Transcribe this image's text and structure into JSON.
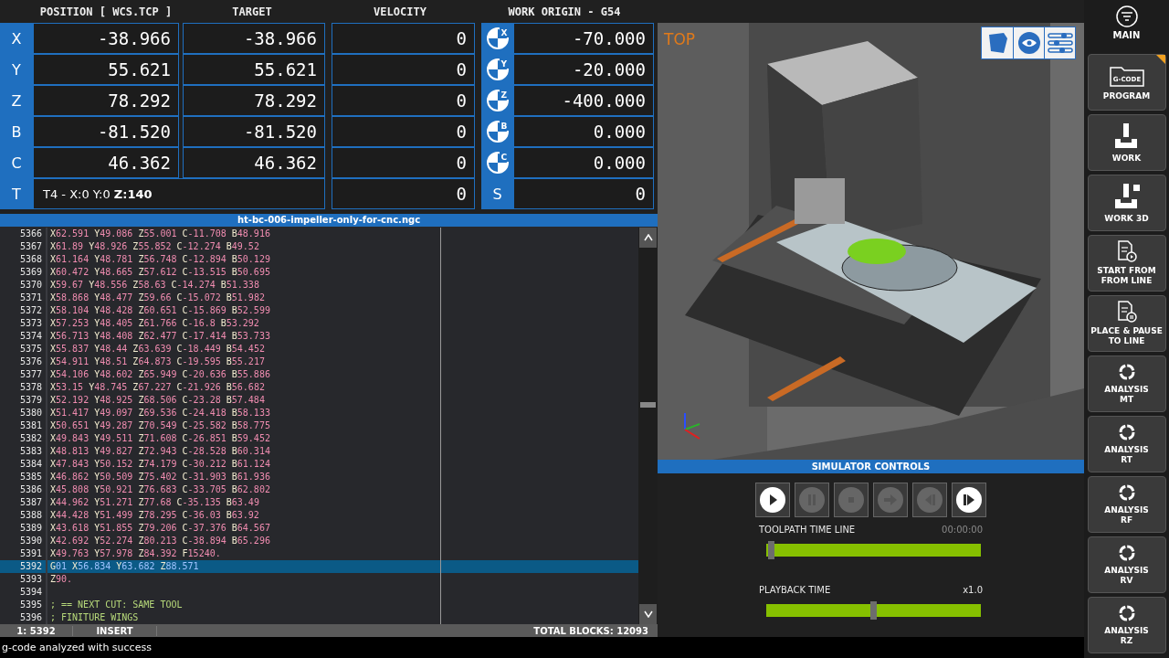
{
  "dro": {
    "headers": [
      "POSITION [ WCS.TCP ]",
      "TARGET",
      "VELOCITY",
      "WORK ORIGIN - G54"
    ],
    "axes": [
      {
        "label": "X",
        "position": {
          "value": "-38.966"
        },
        "target": {
          "value": "-38.966"
        },
        "velocity": {
          "value": "0"
        },
        "origin_letter": "X",
        "origin": {
          "value": "-70.000"
        }
      },
      {
        "label": "Y",
        "position": {
          "value": "55.621"
        },
        "target": {
          "value": "55.621"
        },
        "velocity": {
          "value": "0"
        },
        "origin_letter": "Y",
        "origin": {
          "value": "-20.000"
        }
      },
      {
        "label": "Z",
        "position": {
          "value": "78.292"
        },
        "target": {
          "value": "78.292"
        },
        "velocity": {
          "value": "0"
        },
        "origin_letter": "Z",
        "origin": {
          "value": "-400.000"
        }
      },
      {
        "label": "B",
        "position": {
          "value": "-81.520"
        },
        "target": {
          "value": "-81.520"
        },
        "velocity": {
          "value": "0"
        },
        "origin_letter": "B",
        "origin": {
          "value": "0.000"
        }
      },
      {
        "label": "C",
        "position": {
          "value": "46.362"
        },
        "target": {
          "value": "46.362"
        },
        "velocity": {
          "value": "0"
        },
        "origin_letter": "C",
        "origin": {
          "value": "0.000"
        }
      }
    ],
    "tool": {
      "label": "T",
      "text": "T4 - X:0 Y:0 **Z:140**",
      "velocity": {
        "value": "0"
      }
    },
    "spindle": {
      "label": "S",
      "value": "0"
    }
  },
  "editor": {
    "title": "ht-bc-006-impeller-only-for-cnc.ngc",
    "lines": [
      {
        "number": "5366",
        "kind": "code",
        "text": "X62.591 Y49.086 Z55.001 C-11.708 B48.916",
        "selected": false
      },
      {
        "number": "5367",
        "kind": "code",
        "text": "X61.89 Y48.926 Z55.852 C-12.274 B49.52",
        "selected": false
      },
      {
        "number": "5368",
        "kind": "code",
        "text": "X61.164 Y48.781 Z56.748 C-12.894 B50.129",
        "selected": false
      },
      {
        "number": "5369",
        "kind": "code",
        "text": "X60.472 Y48.665 Z57.612 C-13.515 B50.695",
        "selected": false
      },
      {
        "number": "5370",
        "kind": "code",
        "text": "X59.67 Y48.556 Z58.63 C-14.274 B51.338",
        "selected": false
      },
      {
        "number": "5371",
        "kind": "code",
        "text": "X58.868 Y48.477 Z59.66 C-15.072 B51.982",
        "selected": false
      },
      {
        "number": "5372",
        "kind": "code",
        "text": "X58.104 Y48.428 Z60.651 C-15.869 B52.599",
        "selected": false
      },
      {
        "number": "5373",
        "kind": "code",
        "text": "X57.253 Y48.405 Z61.766 C-16.8 B53.292",
        "selected": false
      },
      {
        "number": "5374",
        "kind": "code",
        "text": "X56.713 Y48.408 Z62.477 C-17.414 B53.733",
        "selected": false
      },
      {
        "number": "5375",
        "kind": "code",
        "text": "X55.837 Y48.44 Z63.639 C-18.449 B54.452",
        "selected": false
      },
      {
        "number": "5376",
        "kind": "code",
        "text": "X54.911 Y48.51 Z64.873 C-19.595 B55.217",
        "selected": false
      },
      {
        "number": "5377",
        "kind": "code",
        "text": "X54.106 Y48.602 Z65.949 C-20.636 B55.886",
        "selected": false
      },
      {
        "number": "5378",
        "kind": "code",
        "text": "X53.15 Y48.745 Z67.227 C-21.926 B56.682",
        "selected": false
      },
      {
        "number": "5379",
        "kind": "code",
        "text": "X52.192 Y48.925 Z68.506 C-23.28 B57.484",
        "selected": false
      },
      {
        "number": "5380",
        "kind": "code",
        "text": "X51.417 Y49.097 Z69.536 C-24.418 B58.133",
        "selected": false
      },
      {
        "number": "5381",
        "kind": "code",
        "text": "X50.651 Y49.287 Z70.549 C-25.582 B58.775",
        "selected": false
      },
      {
        "number": "5382",
        "kind": "code",
        "text": "X49.843 Y49.511 Z71.608 C-26.851 B59.452",
        "selected": false
      },
      {
        "number": "5383",
        "kind": "code",
        "text": "X48.813 Y49.827 Z72.943 C-28.528 B60.314",
        "selected": false
      },
      {
        "number": "5384",
        "kind": "code",
        "text": "X47.843 Y50.152 Z74.179 C-30.212 B61.124",
        "selected": false
      },
      {
        "number": "5385",
        "kind": "code",
        "text": "X46.862 Y50.509 Z75.402 C-31.903 B61.936",
        "selected": false
      },
      {
        "number": "5386",
        "kind": "code",
        "text": "X45.808 Y50.921 Z76.683 C-33.705 B62.802",
        "selected": false
      },
      {
        "number": "5387",
        "kind": "code",
        "text": "X44.962 Y51.271 Z77.68 C-35.135 B63.49",
        "selected": false
      },
      {
        "number": "5388",
        "kind": "code",
        "text": "X44.428 Y51.499 Z78.295 C-36.03 B63.92",
        "selected": false
      },
      {
        "number": "5389",
        "kind": "code",
        "text": "X43.618 Y51.855 Z79.206 C-37.376 B64.567",
        "selected": false
      },
      {
        "number": "5390",
        "kind": "code",
        "text": "X42.692 Y52.274 Z80.213 C-38.894 B65.296",
        "selected": false
      },
      {
        "number": "5391",
        "kind": "code",
        "text": "X49.763 Y57.978 Z84.392 F15240.",
        "selected": false
      },
      {
        "number": "5392",
        "kind": "code",
        "text": "G01 X56.834 Y63.682 Z88.571",
        "selected": true
      },
      {
        "number": "5393",
        "kind": "code",
        "text": "Z90.",
        "selected": false
      },
      {
        "number": "5394",
        "kind": "blank",
        "selected": false
      },
      {
        "number": "5395",
        "kind": "comment",
        "text": "; == NEXT CUT: SAME TOOL",
        "selected": false
      },
      {
        "number": "5396",
        "kind": "comment",
        "text": "; FINITURE WINGS",
        "selected": false
      }
    ],
    "status": {
      "position": "1: 5392",
      "mode": "INSERT",
      "total": "TOTAL BLOCKS:  12093"
    }
  },
  "viewport": {
    "view_label": "TOP",
    "tools": [
      {
        "kind": "cube"
      },
      {
        "kind": "eye"
      },
      {
        "kind": "sliders"
      }
    ]
  },
  "simulator": {
    "title": "SIMULATOR CONTROLS",
    "buttons": [
      {
        "kind": "play",
        "disabled": false
      },
      {
        "kind": "pause",
        "disabled": true
      },
      {
        "kind": "stop",
        "disabled": true
      },
      {
        "kind": "step",
        "disabled": true
      },
      {
        "kind": "back",
        "disabled": true
      },
      {
        "kind": "forward",
        "disabled": false
      }
    ],
    "sliders": [
      {
        "label": "TOOLPATH TIME LINE",
        "reading": "00:00:00",
        "level": 0.01,
        "dim": true
      },
      {
        "label": "PLAYBACK TIME",
        "reading": "x1.0",
        "level": 0.5,
        "dim": false
      }
    ]
  },
  "message": "g-code analyzed with success",
  "sidebar": {
    "main": "MAIN",
    "items": [
      {
        "kind": "program",
        "label": "PROGRAM",
        "badge": "G-CODE",
        "flagged": true
      },
      {
        "kind": "work",
        "label": "WORK",
        "flagged": false
      },
      {
        "kind": "work3d",
        "label": "WORK 3D",
        "flagged": false
      },
      {
        "kind": "start",
        "label": "START FROM\nFROM LINE",
        "flagged": false
      },
      {
        "kind": "pause",
        "label": "PLACE & PAUSE\nTO LINE",
        "flagged": false
      },
      {
        "kind": "analysis",
        "label": "ANALYSIS\nMT",
        "flagged": false
      },
      {
        "kind": "analysis",
        "label": "ANALYSIS\nRT",
        "flagged": false
      },
      {
        "kind": "analysis",
        "label": "ANALYSIS\nRF",
        "flagged": false
      },
      {
        "kind": "analysis",
        "label": "ANALYSIS\nRV",
        "flagged": false
      },
      {
        "kind": "analysis",
        "label": "ANALYSIS\nRZ",
        "flagged": false
      }
    ]
  }
}
